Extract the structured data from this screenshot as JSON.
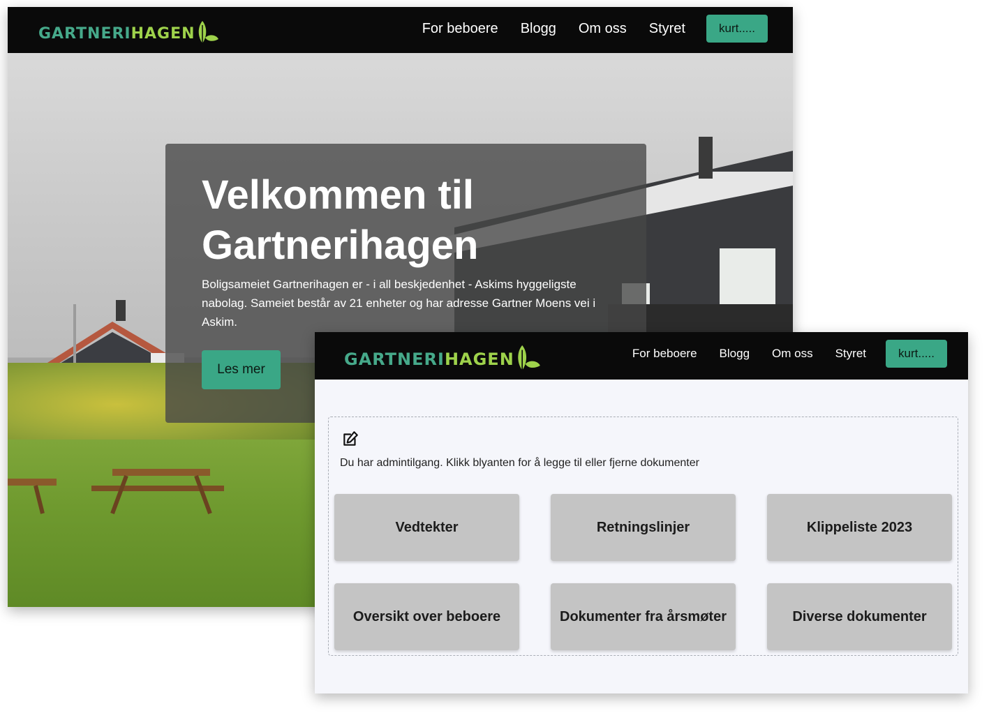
{
  "brand": {
    "name_part1": "GARTNERI",
    "name_part2": "HAGEN",
    "green": "#46a98a",
    "lime": "#9ed24b"
  },
  "nav": {
    "items": [
      "For beboere",
      "Blogg",
      "Om oss",
      "Styret"
    ],
    "user_button": "kurt....."
  },
  "hero": {
    "title": "Velkommen til Gartnerihagen",
    "text": "Boligsameiet Gartnerihagen er - i all beskjedenhet - Askims hyggeligste nabolag. Sameiet består av 21 enheter og har adresse Gartner Moens vei i Askim.",
    "button": "Les mer"
  },
  "docs": {
    "admin_note": "Du har admintilgang. Klikk blyanten for å legge til eller fjerne dokumenter",
    "cards": [
      "Vedtekter",
      "Retningslinjer",
      "Klippeliste 2023",
      "Oversikt over beboere",
      "Dokumenter fra årsmøter",
      "Diverse dokumenter"
    ]
  },
  "colors": {
    "accent": "#3aa786",
    "navbar": "#0a0a0a",
    "card": "#c4c4c4"
  },
  "icons": {
    "logo_leaf": "leaf-icon",
    "edit": "pencil-square-icon"
  }
}
